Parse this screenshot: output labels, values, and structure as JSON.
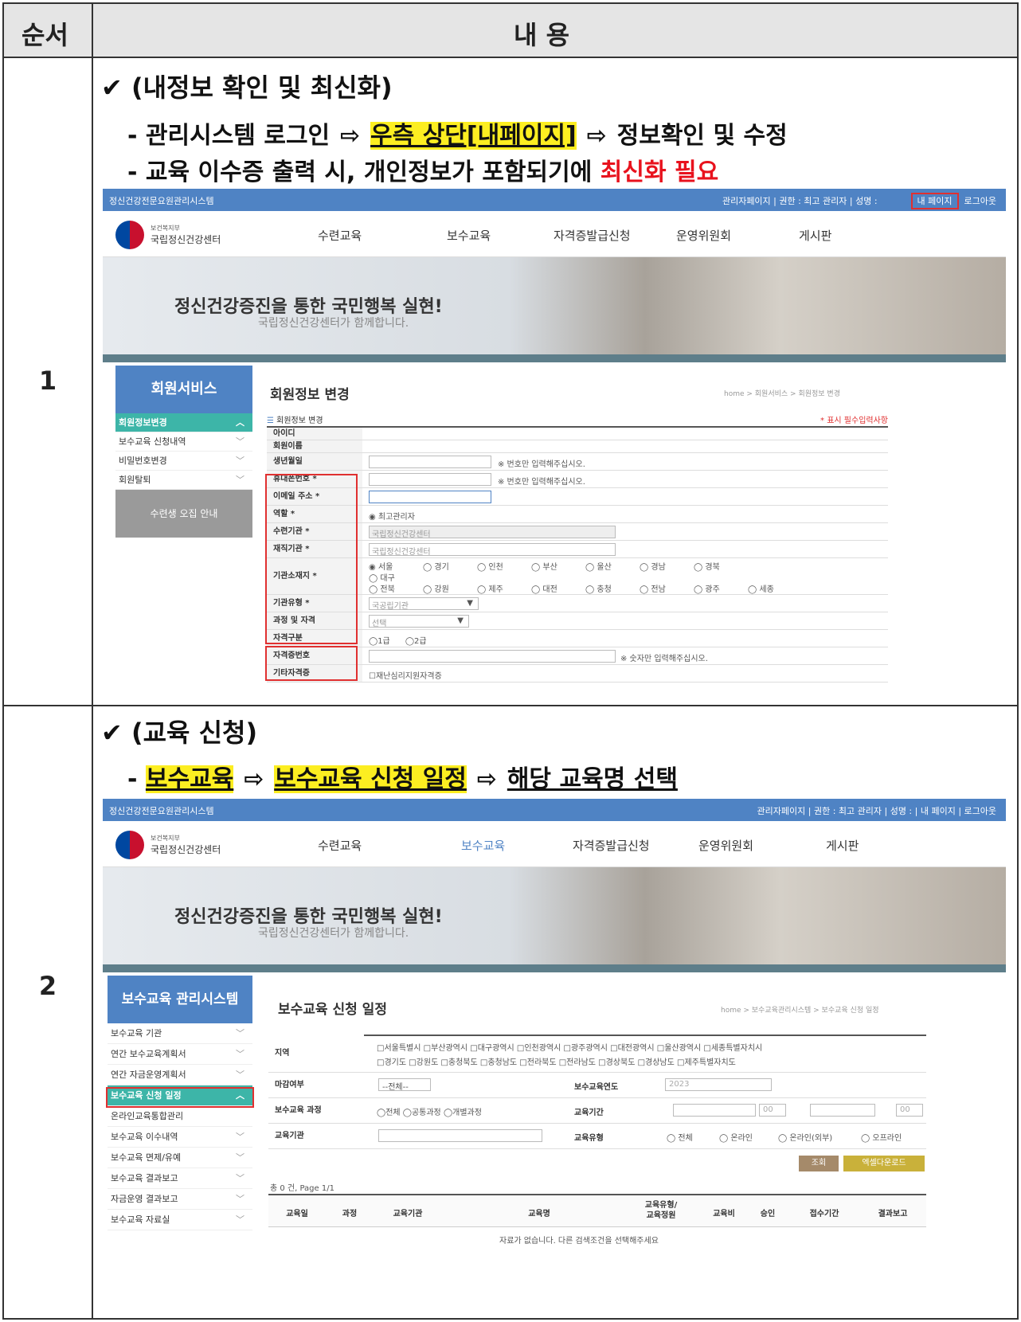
{
  "header": {
    "col1": "순서",
    "col2": "내 용"
  },
  "row1": {
    "num": "1",
    "title": "✔ (내정보 확인 및 최신화)",
    "line1": {
      "dash": "- 관리시스템 로그인 ",
      "arrow": "⇨",
      "hl": "우측 상단[내페이지]",
      "rest": " 정보확인 및 수정"
    },
    "line2": {
      "text": "- 교육 이수증 출력 시, 개인정보가 포함되기에 ",
      "red": "최신화 필요"
    },
    "shot": {
      "topbar_left": "정신건강전문요원관리시스템",
      "topbar_mid": "관리자페이지 | 권한 : 최고 관리자 | 성명 :",
      "mypage": "내 페이지",
      "logout": "로그아웃",
      "logo_small": "보건복지부",
      "logo_big": "국립정신건강센터",
      "nav": [
        "수련교육",
        "보수교육",
        "자격증발급신청",
        "운영위원회",
        "게시판"
      ],
      "banner_main": "정신건강증진을 통한 국민행복 실현!",
      "banner_sub": "국립정신건강센터가 함께합니다.",
      "side_head": "회원서비스",
      "side_items": [
        "회원정보변경",
        "보수교육 신청내역",
        "비밀번호변경",
        "회원탈퇴"
      ],
      "side_gray": "수련생 오집 안내",
      "page_title": "회원정보 변경",
      "crumb": "home  >  회원서비스  >  회원정보 변경",
      "form_title": "회원정보 변경",
      "required_note": "* 표시 필수입력사항",
      "labels": [
        "아이디",
        "회원이름",
        "생년월일",
        "휴대폰번호 *",
        "이메일 주소 *",
        "역할 *",
        "수련기관 *",
        "재직기관 *",
        "기관소재지 *",
        "기관유형 *",
        "과정 및 자격",
        "자격구분",
        "자격증번호",
        "기타자격증"
      ],
      "hint_num": "※ 번호만 입력해주십시오.",
      "role": "최고관리자",
      "training_org": "국립정신건강센터",
      "work_org": "국립정신건강센터",
      "regions1": [
        "서울",
        "경기",
        "인천",
        "부산",
        "울산",
        "경남",
        "경북"
      ],
      "regions2": [
        "대구"
      ],
      "regions3": [
        "전북",
        "강원",
        "제주",
        "대전",
        "충청",
        "전남",
        "광주",
        "세종"
      ],
      "org_type": "국공립기관",
      "course": "선택",
      "grade1": "1급",
      "grade2": "2급",
      "hint_digits": "※ 숫자만 입력해주십시오.",
      "etc": "재난심리지원자격증"
    }
  },
  "row2": {
    "num": "2",
    "title": "✔ (교육 신청)",
    "line": {
      "dash": "- ",
      "hl1": "보수교육",
      "arrow": "⇨",
      "hl2": "보수교육 신청 일정",
      "ul": "해당 교육명 선택"
    },
    "shot": {
      "topbar_left": "정신건강전문요원관리시스템",
      "topbar_right": "관리자페이지 | 권한 : 최고 관리자 | 성명 :        | 내 페이지 | 로그아웃",
      "logo_small": "보건복지부",
      "logo_big": "국립정신건강센터",
      "nav": [
        "수련교육",
        "보수교육",
        "자격증발급신청",
        "운영위원회",
        "게시판"
      ],
      "banner_main": "정신건강증진을 통한 국민행복 실현!",
      "banner_sub": "국립정신건강센터가 함께합니다.",
      "side_head": "보수교육 관리시스템",
      "side_items": [
        "보수교육 기관",
        "연간 보수교육계획서",
        "연간 자금운영계획서",
        "보수교육 신청 일정",
        "온라인교육통합관리",
        "보수교육 이수내역",
        "보수교육 면제/유예",
        "보수교육 결과보고",
        "자금운영 결과보고",
        "보수교육 자료실"
      ],
      "page_title": "보수교육 신청 일정",
      "crumb": "home  >  보수교육관리시스템  >  보수교육 신청 일정",
      "f_region": "지역",
      "regions_a": "□서울특별시 □부산광역시 □대구광역시 □인천광역시 □광주광역시 □대전광역시 □울산광역시 □세종특별자치시",
      "regions_b": "□경기도 □강원도 □충청북도 □충청남도 □전라북도 □전라남도 □경상북도 □경상남도 □제주특별자치도",
      "f_deadline": "마감여부",
      "deadline_val": "--전체--",
      "f_year": "보수교육연도",
      "year_val": "2023",
      "f_course": "보수교육 과정",
      "course_opts": "◯전체 ◯공통과정 ◯개별과정",
      "f_period": "교육기간",
      "period_h": "00",
      "f_org": "교육기관",
      "f_type": "교육유형",
      "type_opts": [
        "전체",
        "온라인",
        "온라인(외부)",
        "오프라인"
      ],
      "btn_search": "조회",
      "btn_excel": "엑셀다운로드",
      "count": "총 0 건, Page 1/1",
      "cols": [
        "교육일",
        "과정",
        "교육기관",
        "교육명",
        "교육유형/교육정원",
        "교육비",
        "승인",
        "접수기간",
        "결과보고"
      ],
      "empty": "자료가 없습니다. 다른 검색조건을 선택해주세요"
    }
  }
}
